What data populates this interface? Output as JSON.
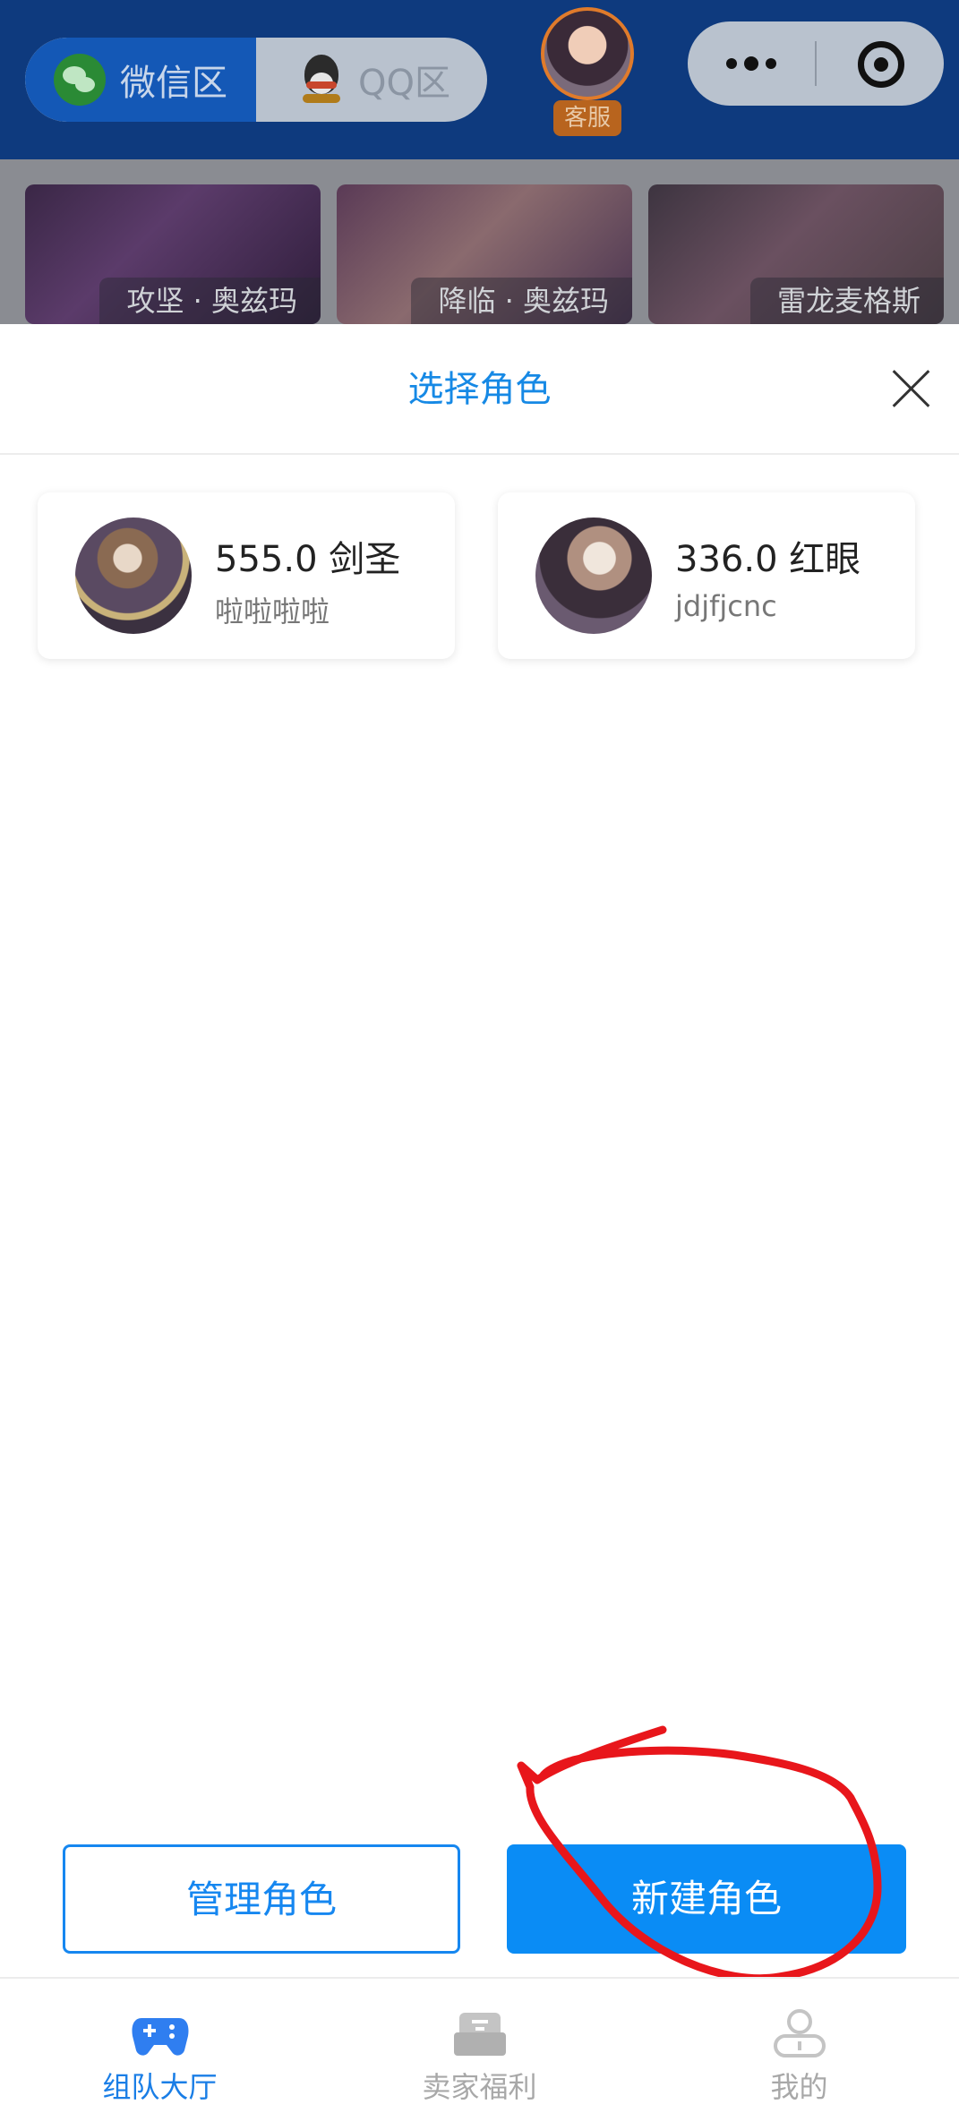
{
  "topbar": {
    "zones": [
      {
        "label": "微信区",
        "icon": "wechat-icon",
        "selected": true
      },
      {
        "label": "QQ区",
        "icon": "qq-icon",
        "selected": false
      }
    ],
    "support_label": "客服",
    "capsule": {
      "more_icon": "more-dots-icon",
      "close_icon": "mini-program-close-icon"
    }
  },
  "banners": [
    {
      "label": "攻坚 · 奥兹玛"
    },
    {
      "label": "降临 · 奥兹玛"
    },
    {
      "label": "雷龙麦格斯"
    }
  ],
  "sheet": {
    "title": "选择角色",
    "close_icon": "close-icon",
    "roles": [
      {
        "score": "555.0",
        "class": "剑圣",
        "name": "啦啦啦啦"
      },
      {
        "score": "336.0",
        "class": "红眼",
        "name": "jdjfjcnc"
      }
    ],
    "manage_label": "管理角色",
    "new_label": "新建角色"
  },
  "tabbar": {
    "items": [
      {
        "label": "组队大厅",
        "icon": "gamepad-icon",
        "active": true
      },
      {
        "label": "卖家福利",
        "icon": "gift-box-icon",
        "active": false
      },
      {
        "label": "我的",
        "icon": "user-icon",
        "active": false
      }
    ]
  },
  "colors": {
    "accent": "#0a8cf5",
    "title_blue": "#1689e5",
    "topbar_bg": "#0e3a7e",
    "annotation_red": "#e8161b"
  }
}
